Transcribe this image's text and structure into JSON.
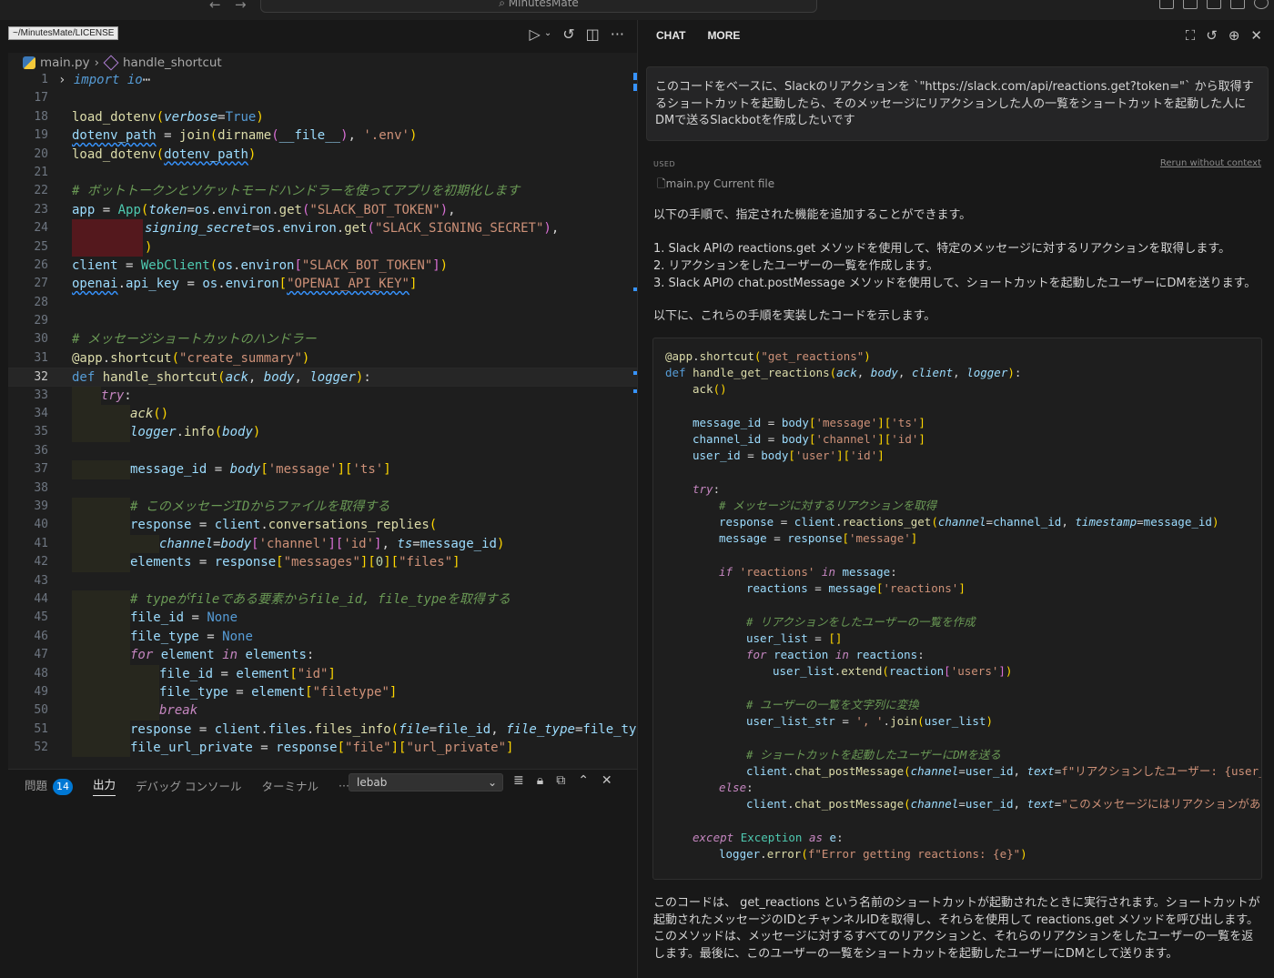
{
  "window": {
    "title": "MinutesMate",
    "tab_tooltip": "~/MinutesMate/LICENSE"
  },
  "editor": {
    "breadcrumb": {
      "file": "main.py",
      "symbol": "handle_shortcut"
    },
    "current_line": "32",
    "line_numbers": [
      "1",
      "17",
      "18",
      "19",
      "20",
      "21",
      "22",
      "23",
      "24",
      "25",
      "26",
      "27",
      "28",
      "29",
      "30",
      "31",
      "32",
      "33",
      "34",
      "35",
      "36",
      "37",
      "38",
      "39",
      "40",
      "41",
      "42",
      "43",
      "44",
      "45",
      "46",
      "47",
      "48",
      "49",
      "50",
      "51",
      "52"
    ],
    "folded_import": "import io",
    "comments": {
      "c22": "# ボットトークンとソケットモードハンドラーを使ってアプリを初期化します",
      "c30": "# メッセージショートカットのハンドラー",
      "c39": "# このメッセージIDからファイルを取得する",
      "c44": "# typeがfileである要素からfile_id, file_typeを取得する"
    },
    "strings": {
      "env": "'.env'",
      "bot_token": "\"SLACK_BOT_TOKEN\"",
      "signing": "\"SLACK_SIGNING_SECRET\"",
      "bot_token2": "\"SLACK_BOT_TOKEN\"",
      "openai": "\"OPENAI_API_KEY\"",
      "create_summary": "\"create_summary\"",
      "message": "'message'",
      "ts": "'ts'",
      "channel": "'channel'",
      "id": "'id'",
      "messages": "\"messages\"",
      "files": "\"files\"",
      "id2": "\"id\"",
      "filetype": "\"filetype\"",
      "file": "\"file\"",
      "url_private": "\"url_private\""
    }
  },
  "panel": {
    "tabs": [
      "問題",
      "出力",
      "デバッグ コンソール",
      "ターミナル"
    ],
    "problems_count": "14",
    "more": "···",
    "output_channel": "lebab"
  },
  "chat": {
    "tabs": [
      "CHAT",
      "MORE"
    ],
    "prompt": "このコードをベースに、Slackのリアクションを `\"https://slack.com/api/reactions.get?token=\"` から取得するショートカットを起動したら、そのメッセージにリアクションした人の一覧をショートカットを起動した人にDMで送るSlackbotを作成したいです",
    "used_label": "USED",
    "rerun_label": "Rerun without context",
    "used_file": "main.py Current file",
    "intro": "以下の手順で、指定された機能を追加することができます。",
    "steps": [
      "1. Slack APIの reactions.get メソッドを使用して、特定のメッセージに対するリアクションを取得します。",
      "2. リアクションをしたユーザーの一覧を作成します。",
      "3. Slack APIの chat.postMessage メソッドを使用して、ショートカットを起動したユーザーにDMを送ります。"
    ],
    "code_intro": "以下に、これらの手順を実装したコードを示します。",
    "code_comments": {
      "c1": "# メッセージに対するリアクションを取得",
      "c2": "# リアクションをしたユーザーの一覧を作成",
      "c3": "# ユーザーの一覧を文字列に変換",
      "c4": "# ショートカットを起動したユーザーにDMを送る"
    },
    "code_strings": {
      "get_reactions": "\"get_reactions\"",
      "dm1": "f\"リアクションしたユーザー: {user_",
      "dm2": "\"このメッセージにはリアクションがあ",
      "err": "f\"Error getting reactions: {e}\""
    },
    "summary": "このコードは、 get_reactions という名前のショートカットが起動されたときに実行されます。ショートカットが起動されたメッセージのIDとチャンネルIDを取得し、それらを使用して reactions.get メソッドを呼び出します。このメソッドは、メッセージに対するすべてのリアクションと、それらのリアクションをしたユーザーの一覧を返します。最後に、このユーザーの一覧をショートカットを起動したユーザーにDMとして送ります。"
  }
}
